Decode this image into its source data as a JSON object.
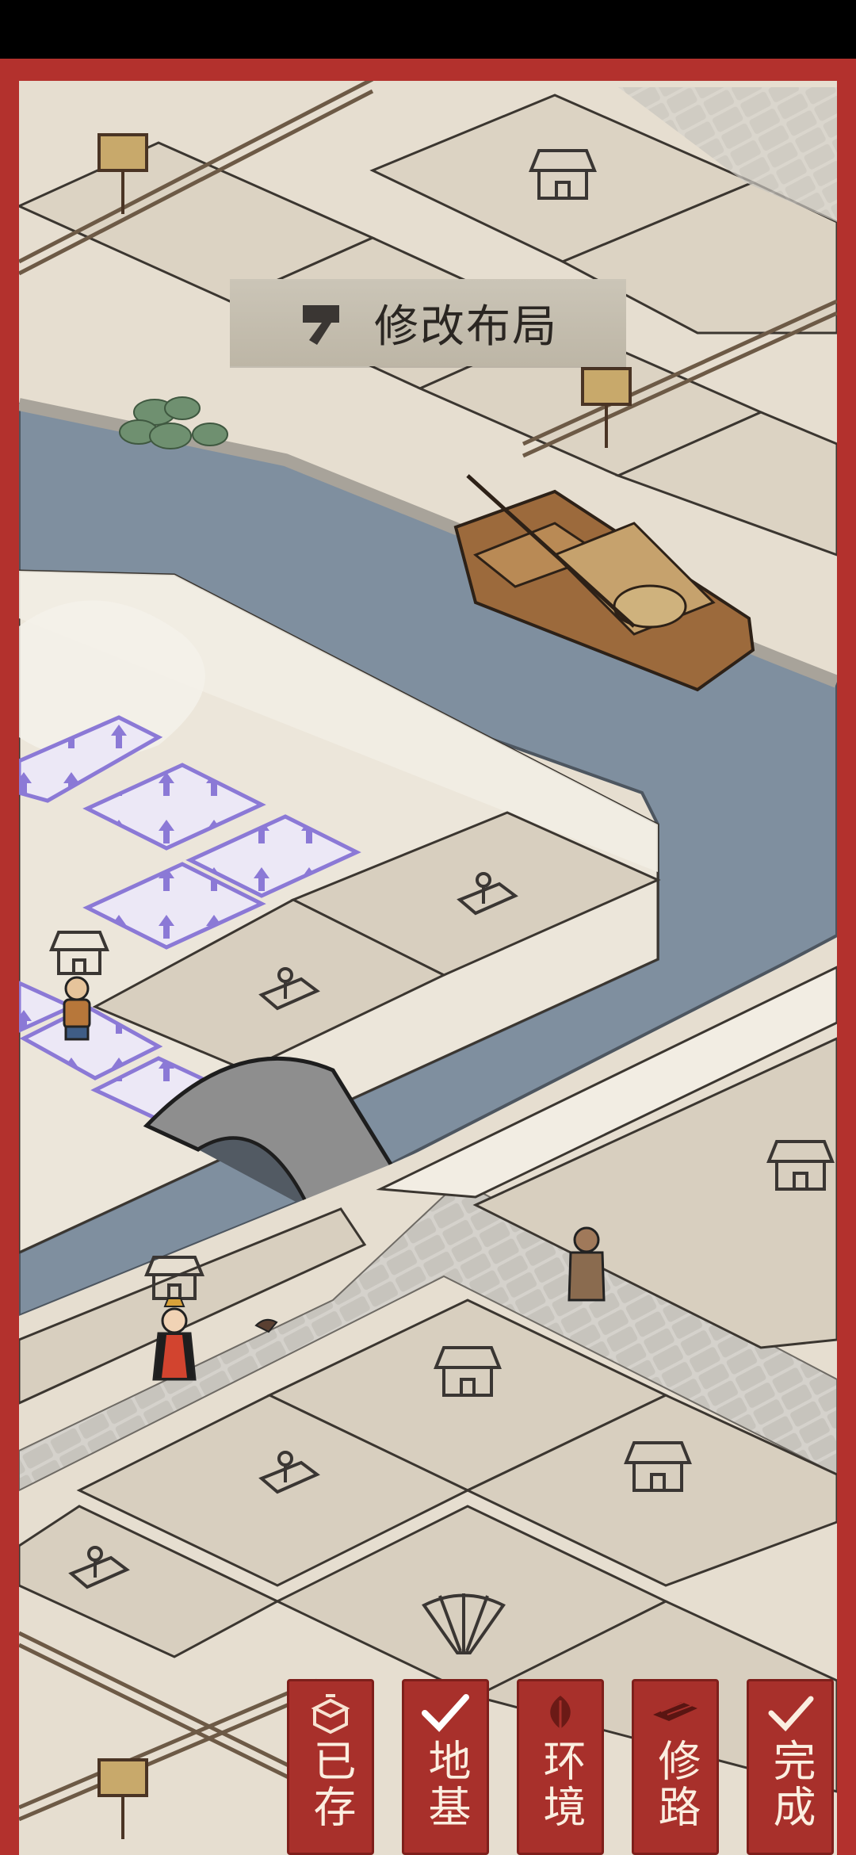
{
  "banner": {
    "label": "修改布局",
    "icon": "hammer-icon"
  },
  "toolbar": {
    "saved": "已存",
    "foundation": "地基",
    "environment": "环境",
    "road": "修路",
    "done": "完成"
  },
  "colors": {
    "frame": "#b3312d",
    "water": "#7e8e9e",
    "ground": "#e6ded0",
    "plot": "#d8cfbf",
    "button": "#a8302b"
  }
}
